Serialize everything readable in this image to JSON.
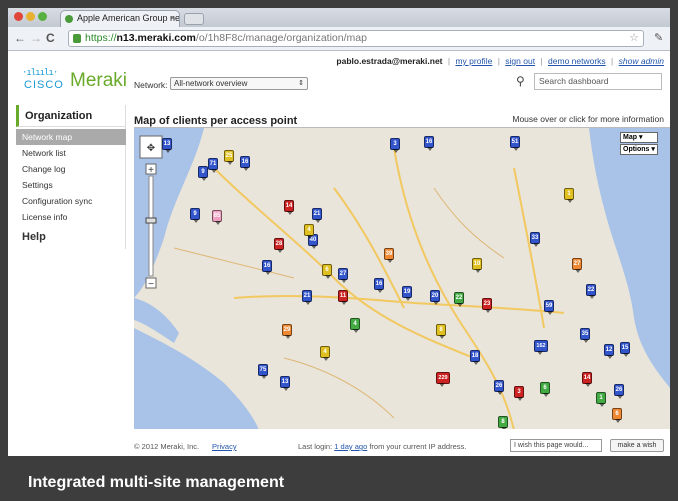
{
  "browser": {
    "tab_title": "Apple American Group netw",
    "tab_close": "×",
    "url_scheme": "https://",
    "url_domain": "n13.meraki.com",
    "url_path": "/o/1h8F8c/manage/organization/map"
  },
  "header": {
    "user_email": "pablo.estrada@meraki.net",
    "links": [
      "my profile",
      "sign out",
      "demo networks",
      "show admin"
    ],
    "logo_bars": "·ılıılı·",
    "logo_cisco": "CISCO",
    "logo_meraki": "Meraki",
    "network_label": "Network:",
    "network_value": "All-network overview",
    "search_placeholder": "Search dashboard"
  },
  "sidebar": {
    "section": "Organization",
    "items": [
      {
        "label": "Network map",
        "active": true
      },
      {
        "label": "Network list"
      },
      {
        "label": "Change log"
      },
      {
        "label": "Settings"
      },
      {
        "label": "Configuration sync"
      },
      {
        "label": "License info"
      }
    ],
    "help": "Help"
  },
  "map": {
    "title": "Map of clients per access point",
    "hint": "Mouse over or click for more information",
    "type_label": "Map",
    "options_label": "Options",
    "pins": [
      {
        "n": "13",
        "c": "#3355cc"
      },
      {
        "n": "71",
        "c": "#3355cc"
      },
      {
        "n": "25",
        "c": "#e0c020"
      },
      {
        "n": "16",
        "c": "#3355cc"
      },
      {
        "n": "3",
        "c": "#3355cc"
      },
      {
        "n": "16",
        "c": "#3355cc"
      },
      {
        "n": "51",
        "c": "#3355cc"
      },
      {
        "n": "9",
        "c": "#3355cc"
      },
      {
        "n": "85",
        "c": "#f0a0c0"
      },
      {
        "n": "14",
        "c": "#cc2222"
      },
      {
        "n": "21",
        "c": "#3355cc"
      },
      {
        "n": "28",
        "c": "#cc2222"
      },
      {
        "n": "40",
        "c": "#3355cc"
      },
      {
        "n": "6",
        "c": "#e0c020"
      },
      {
        "n": "27",
        "c": "#3355cc"
      },
      {
        "n": "16",
        "c": "#3355cc"
      },
      {
        "n": "21",
        "c": "#3355cc"
      },
      {
        "n": "11",
        "c": "#cc2222"
      },
      {
        "n": "16",
        "c": "#3355cc"
      },
      {
        "n": "39",
        "c": "#ee8833"
      },
      {
        "n": "19",
        "c": "#3355cc"
      },
      {
        "n": "20",
        "c": "#3355cc"
      },
      {
        "n": "22",
        "c": "#44aa44"
      },
      {
        "n": "23",
        "c": "#cc2222"
      },
      {
        "n": "8",
        "c": "#e0c020"
      },
      {
        "n": "59",
        "c": "#3355cc"
      },
      {
        "n": "33",
        "c": "#3355cc"
      },
      {
        "n": "22",
        "c": "#3355cc"
      },
      {
        "n": "4",
        "c": "#e0c020"
      },
      {
        "n": "75",
        "c": "#3355cc"
      },
      {
        "n": "13",
        "c": "#3355cc"
      },
      {
        "n": "162",
        "c": "#3355cc"
      },
      {
        "n": "35",
        "c": "#3355cc"
      },
      {
        "n": "229",
        "c": "#cc2222"
      },
      {
        "n": "26",
        "c": "#3355cc"
      },
      {
        "n": "14",
        "c": "#cc2222"
      },
      {
        "n": "6",
        "c": "#ee8833"
      },
      {
        "n": "15",
        "c": "#3355cc"
      },
      {
        "n": "12",
        "c": "#3355cc"
      },
      {
        "n": "1",
        "c": "#e0c020"
      },
      {
        "n": "10",
        "c": "#e0c020"
      },
      {
        "n": "27",
        "c": "#ee8833"
      },
      {
        "n": "9",
        "c": "#3355cc"
      },
      {
        "n": "4",
        "c": "#e0c020"
      },
      {
        "n": "18",
        "c": "#3355cc"
      },
      {
        "n": "3",
        "c": "#cc2222"
      },
      {
        "n": "6",
        "c": "#44aa44"
      },
      {
        "n": "8",
        "c": "#44aa44"
      },
      {
        "n": "26",
        "c": "#3355cc"
      },
      {
        "n": "1",
        "c": "#44aa44"
      },
      {
        "n": "29",
        "c": "#ee8833"
      },
      {
        "n": "4",
        "c": "#44aa44"
      }
    ]
  },
  "footer": {
    "copyright": "© 2012 Meraki, Inc.",
    "privacy": "Privacy",
    "last_login_prefix": "Last login:",
    "last_login_link": "1 day ago",
    "last_login_suffix": "from your current IP address.",
    "wish_placeholder": "I wish this page would...",
    "wish_button": "make a wish"
  },
  "caption": "Integrated multi-site management"
}
